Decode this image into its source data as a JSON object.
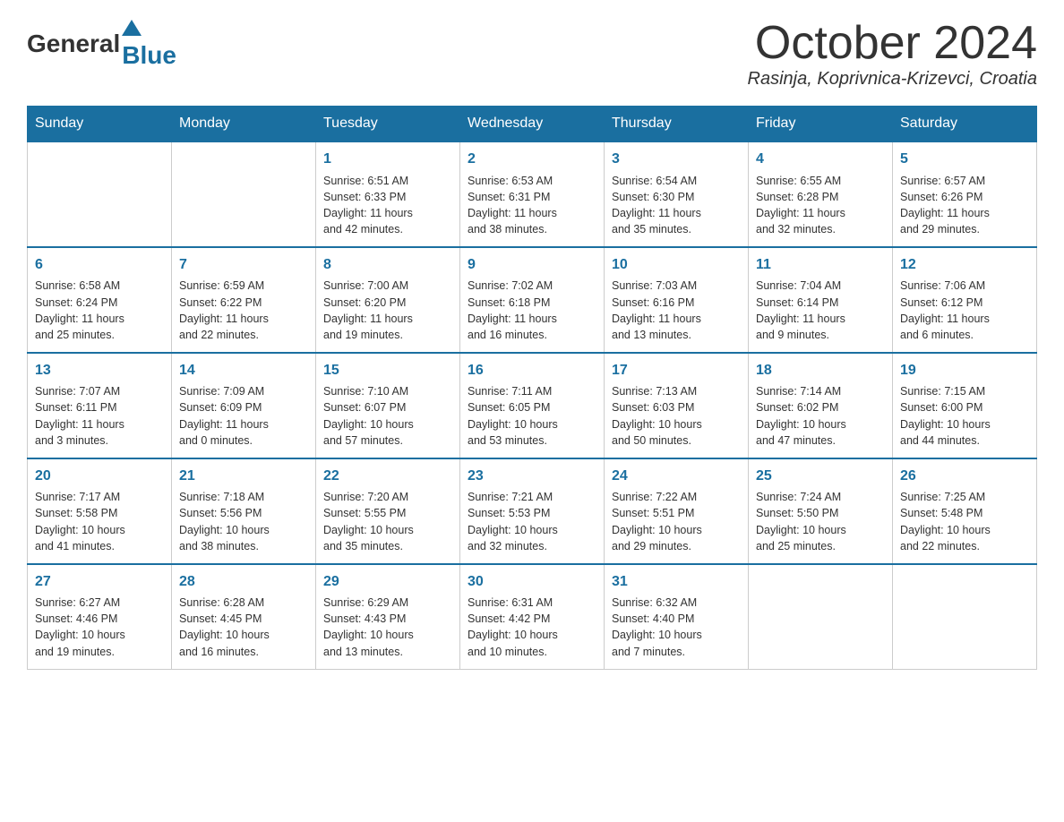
{
  "logo": {
    "general": "General",
    "blue": "Blue"
  },
  "title": {
    "month_year": "October 2024",
    "location": "Rasinja, Koprivnica-Krizevci, Croatia"
  },
  "headers": [
    "Sunday",
    "Monday",
    "Tuesday",
    "Wednesday",
    "Thursday",
    "Friday",
    "Saturday"
  ],
  "weeks": [
    [
      {
        "day": "",
        "info": ""
      },
      {
        "day": "",
        "info": ""
      },
      {
        "day": "1",
        "info": "Sunrise: 6:51 AM\nSunset: 6:33 PM\nDaylight: 11 hours\nand 42 minutes."
      },
      {
        "day": "2",
        "info": "Sunrise: 6:53 AM\nSunset: 6:31 PM\nDaylight: 11 hours\nand 38 minutes."
      },
      {
        "day": "3",
        "info": "Sunrise: 6:54 AM\nSunset: 6:30 PM\nDaylight: 11 hours\nand 35 minutes."
      },
      {
        "day": "4",
        "info": "Sunrise: 6:55 AM\nSunset: 6:28 PM\nDaylight: 11 hours\nand 32 minutes."
      },
      {
        "day": "5",
        "info": "Sunrise: 6:57 AM\nSunset: 6:26 PM\nDaylight: 11 hours\nand 29 minutes."
      }
    ],
    [
      {
        "day": "6",
        "info": "Sunrise: 6:58 AM\nSunset: 6:24 PM\nDaylight: 11 hours\nand 25 minutes."
      },
      {
        "day": "7",
        "info": "Sunrise: 6:59 AM\nSunset: 6:22 PM\nDaylight: 11 hours\nand 22 minutes."
      },
      {
        "day": "8",
        "info": "Sunrise: 7:00 AM\nSunset: 6:20 PM\nDaylight: 11 hours\nand 19 minutes."
      },
      {
        "day": "9",
        "info": "Sunrise: 7:02 AM\nSunset: 6:18 PM\nDaylight: 11 hours\nand 16 minutes."
      },
      {
        "day": "10",
        "info": "Sunrise: 7:03 AM\nSunset: 6:16 PM\nDaylight: 11 hours\nand 13 minutes."
      },
      {
        "day": "11",
        "info": "Sunrise: 7:04 AM\nSunset: 6:14 PM\nDaylight: 11 hours\nand 9 minutes."
      },
      {
        "day": "12",
        "info": "Sunrise: 7:06 AM\nSunset: 6:12 PM\nDaylight: 11 hours\nand 6 minutes."
      }
    ],
    [
      {
        "day": "13",
        "info": "Sunrise: 7:07 AM\nSunset: 6:11 PM\nDaylight: 11 hours\nand 3 minutes."
      },
      {
        "day": "14",
        "info": "Sunrise: 7:09 AM\nSunset: 6:09 PM\nDaylight: 11 hours\nand 0 minutes."
      },
      {
        "day": "15",
        "info": "Sunrise: 7:10 AM\nSunset: 6:07 PM\nDaylight: 10 hours\nand 57 minutes."
      },
      {
        "day": "16",
        "info": "Sunrise: 7:11 AM\nSunset: 6:05 PM\nDaylight: 10 hours\nand 53 minutes."
      },
      {
        "day": "17",
        "info": "Sunrise: 7:13 AM\nSunset: 6:03 PM\nDaylight: 10 hours\nand 50 minutes."
      },
      {
        "day": "18",
        "info": "Sunrise: 7:14 AM\nSunset: 6:02 PM\nDaylight: 10 hours\nand 47 minutes."
      },
      {
        "day": "19",
        "info": "Sunrise: 7:15 AM\nSunset: 6:00 PM\nDaylight: 10 hours\nand 44 minutes."
      }
    ],
    [
      {
        "day": "20",
        "info": "Sunrise: 7:17 AM\nSunset: 5:58 PM\nDaylight: 10 hours\nand 41 minutes."
      },
      {
        "day": "21",
        "info": "Sunrise: 7:18 AM\nSunset: 5:56 PM\nDaylight: 10 hours\nand 38 minutes."
      },
      {
        "day": "22",
        "info": "Sunrise: 7:20 AM\nSunset: 5:55 PM\nDaylight: 10 hours\nand 35 minutes."
      },
      {
        "day": "23",
        "info": "Sunrise: 7:21 AM\nSunset: 5:53 PM\nDaylight: 10 hours\nand 32 minutes."
      },
      {
        "day": "24",
        "info": "Sunrise: 7:22 AM\nSunset: 5:51 PM\nDaylight: 10 hours\nand 29 minutes."
      },
      {
        "day": "25",
        "info": "Sunrise: 7:24 AM\nSunset: 5:50 PM\nDaylight: 10 hours\nand 25 minutes."
      },
      {
        "day": "26",
        "info": "Sunrise: 7:25 AM\nSunset: 5:48 PM\nDaylight: 10 hours\nand 22 minutes."
      }
    ],
    [
      {
        "day": "27",
        "info": "Sunrise: 6:27 AM\nSunset: 4:46 PM\nDaylight: 10 hours\nand 19 minutes."
      },
      {
        "day": "28",
        "info": "Sunrise: 6:28 AM\nSunset: 4:45 PM\nDaylight: 10 hours\nand 16 minutes."
      },
      {
        "day": "29",
        "info": "Sunrise: 6:29 AM\nSunset: 4:43 PM\nDaylight: 10 hours\nand 13 minutes."
      },
      {
        "day": "30",
        "info": "Sunrise: 6:31 AM\nSunset: 4:42 PM\nDaylight: 10 hours\nand 10 minutes."
      },
      {
        "day": "31",
        "info": "Sunrise: 6:32 AM\nSunset: 4:40 PM\nDaylight: 10 hours\nand 7 minutes."
      },
      {
        "day": "",
        "info": ""
      },
      {
        "day": "",
        "info": ""
      }
    ]
  ]
}
